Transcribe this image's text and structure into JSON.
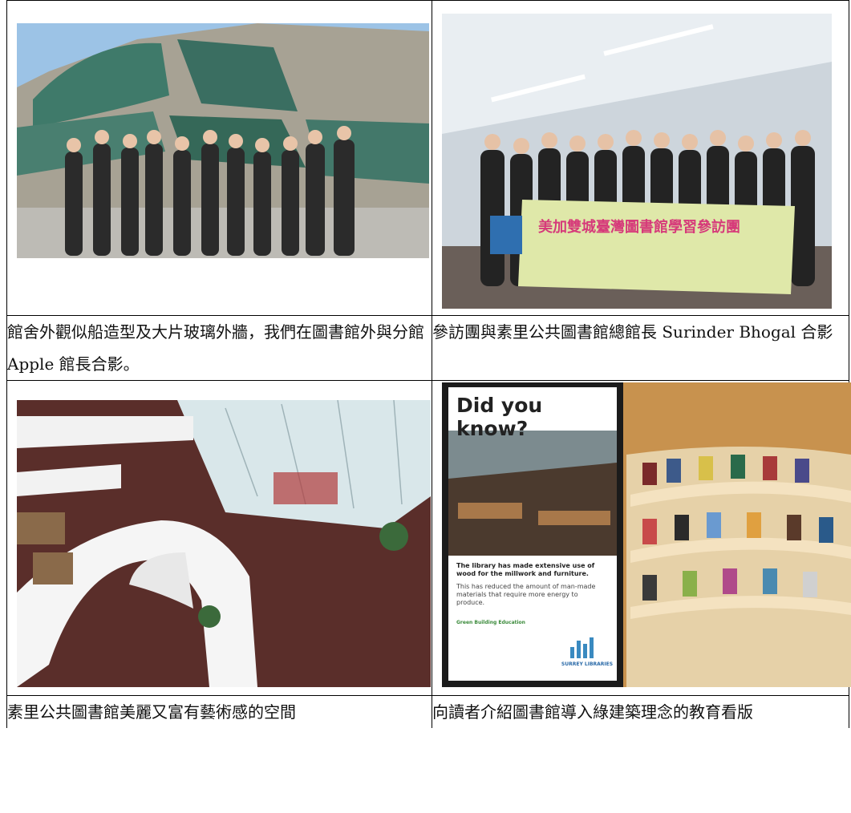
{
  "cells": [
    {
      "caption": "館舍外觀似船造型及大片玻璃外牆，我們在圖書館外與分館 Apple 館長合影。",
      "photo_icon": "group-photo-outside-library-image"
    },
    {
      "caption": "參訪團與素里公共圖書館總館長 Surinder Bhogal 合影",
      "photo_icon": "group-photo-with-banner-image",
      "banner_text": "美加雙城臺灣圖書館學習參訪團"
    },
    {
      "caption": "素里公共圖書館美麗又富有藝術感的空間",
      "photo_icon": "library-atrium-image"
    },
    {
      "caption": "向讀者介紹圖書館導入綠建築理念的教育看版",
      "photo_icon": "green-building-sign-image",
      "sign": {
        "heading": "Did you know?",
        "text1": "The library has made extensive use of wood for the millwork and furniture.",
        "text2": "This has reduced the amount of man-made materials that require more energy to produce.",
        "footer": "Green Building Education",
        "logo": "SURREY LIBRARIES"
      }
    }
  ]
}
